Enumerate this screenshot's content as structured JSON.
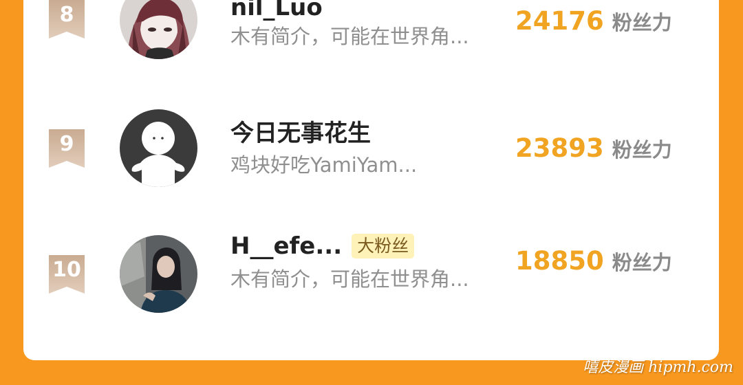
{
  "rows": [
    {
      "rank": "8",
      "name": "nil_Luo",
      "bio": "木有简介，可能在世界角...",
      "score": "24176",
      "score_unit": "粉丝力",
      "tag": ""
    },
    {
      "rank": "9",
      "name": "今日无事花生",
      "bio": "鸡块好吃YamiYam...",
      "score": "23893",
      "score_unit": "粉丝力",
      "tag": ""
    },
    {
      "rank": "10",
      "name": "H__efe...",
      "bio": "木有简介，可能在世界角...",
      "score": "18850",
      "score_unit": "粉丝力",
      "tag": "大粉丝"
    }
  ],
  "watermark": "嘻皮漫画 hipmh.com",
  "colors": {
    "background": "#F8981F",
    "card": "#FFFFFF",
    "score": "#F0A422",
    "rank_badge": "#D9C0AA",
    "tag_bg": "#FFF2B8"
  }
}
